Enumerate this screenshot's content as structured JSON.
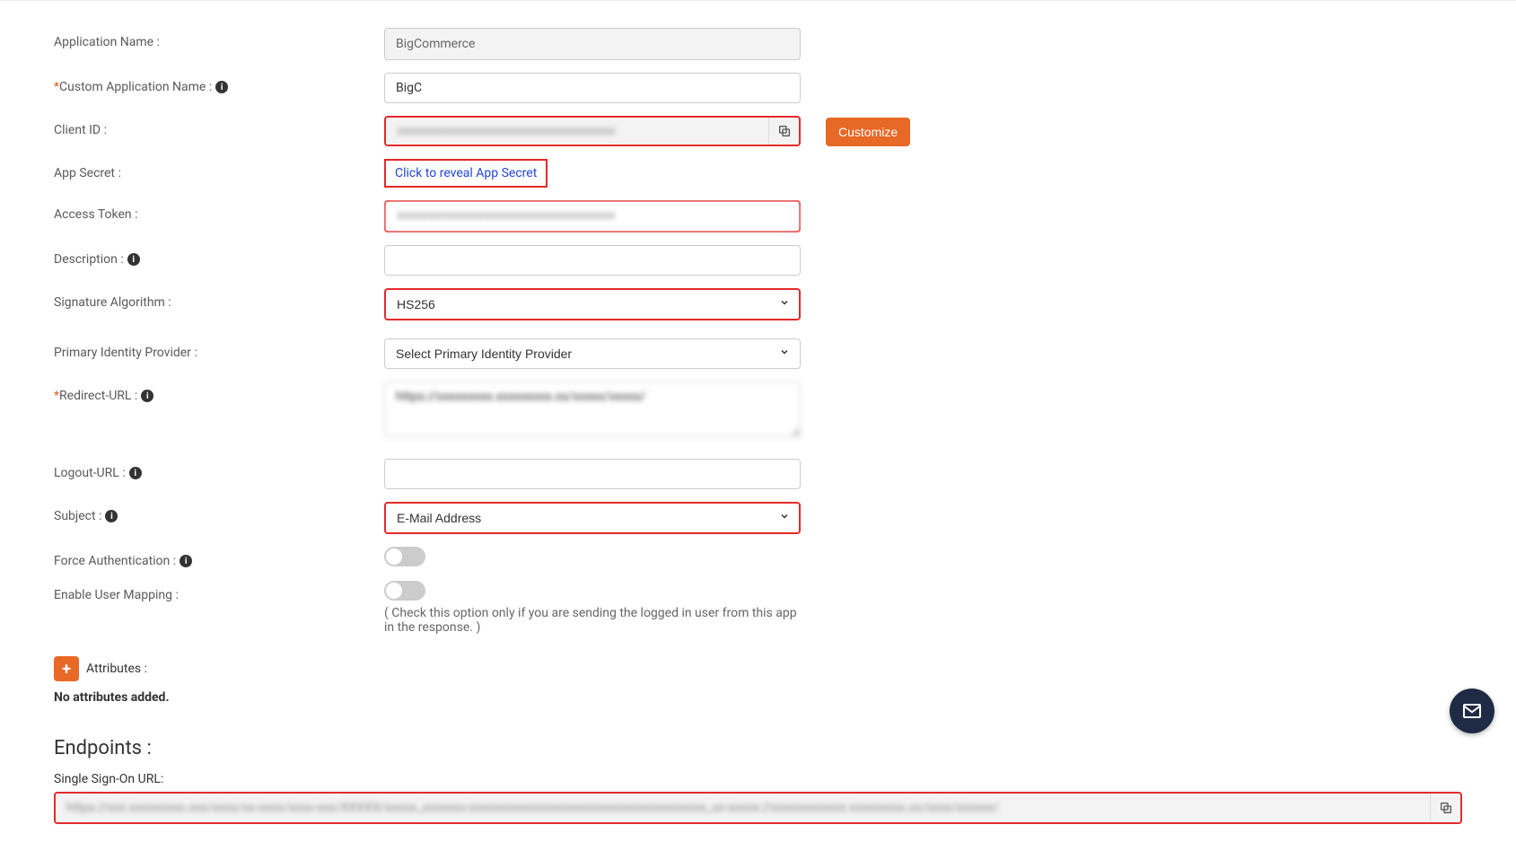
{
  "fields": {
    "applicationName": {
      "label": "Application Name :",
      "value": "BigCommerce"
    },
    "customAppName": {
      "label": "Custom Application Name :",
      "value": "BigC"
    },
    "clientId": {
      "label": "Client ID :",
      "value": "xxxxxxxxxxxxxxxxxxxxxxxxxxxxxxxxxxx"
    },
    "appSecret": {
      "label": "App Secret :",
      "revealText": "Click to reveal App Secret"
    },
    "accessToken": {
      "label": "Access Token :",
      "value": "xxxxxxxxxxxxxxxxxxxxxxxxxxxxxxxxxxx"
    },
    "description": {
      "label": "Description :",
      "value": ""
    },
    "signatureAlgorithm": {
      "label": "Signature Algorithm :",
      "value": "HS256"
    },
    "primaryIdp": {
      "label": "Primary Identity Provider :",
      "value": "Select Primary Identity Provider"
    },
    "redirectUrl": {
      "label": "Redirect-URL :",
      "value": "https://xxxxxxxxx.xxxxxxxxx.xx/xxxxx/xxxxx/"
    },
    "logoutUrl": {
      "label": "Logout-URL :",
      "value": ""
    },
    "subject": {
      "label": "Subject :",
      "value": "E-Mail Address"
    },
    "forceAuth": {
      "label": "Force Authentication :"
    },
    "enableUserMapping": {
      "label": "Enable User Mapping :",
      "hint": "( Check this option only if you are sending the logged in user from this app in the response. )"
    }
  },
  "buttons": {
    "customize": "Customize"
  },
  "attributes": {
    "label": "Attributes :",
    "empty": "No attributes added."
  },
  "endpoints": {
    "heading": "Endpoints :",
    "ssoUrlLabel": "Single Sign-On URL:",
    "ssoUrlValue": "https://xxx.xxxxxxxxx.xxx/xxxx/xx-xxxx/xxxx-xxx/XXXXX/xxxxx_xxxxxxx-xxxxxxxxxxxxxxxxxxxxxxxxxxxxxxxxxxxxxx_xx-xxxxx://xxxxxxxxxxxx.xxxxxxxxx.xx/xxxx/xxxxxx/"
  }
}
